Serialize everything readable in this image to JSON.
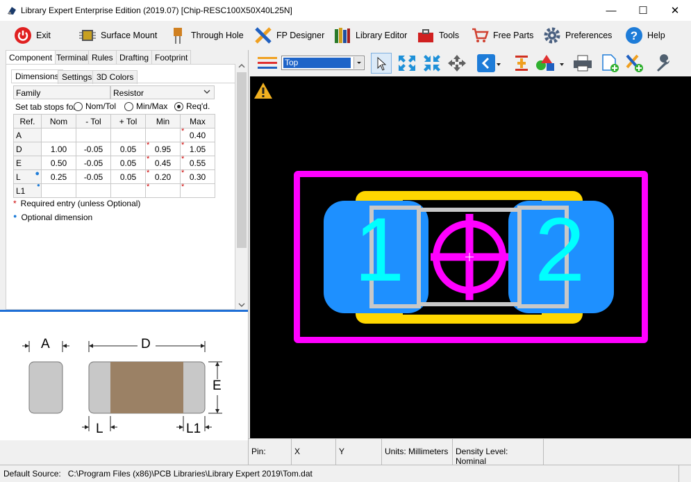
{
  "title": "Library Expert Enterprise Edition (2019.07) [Chip-RESC100X50X40L25N]",
  "window": {
    "minimize": "—",
    "maximize": "☐",
    "close": "✕"
  },
  "toolbar": [
    {
      "label": "Exit",
      "icon": "power-icon"
    },
    {
      "label": "Surface Mount",
      "icon": "chip-icon"
    },
    {
      "label": "Through Hole",
      "icon": "through-hole-icon"
    },
    {
      "label": "FP Designer",
      "icon": "pencil-ruler-icon"
    },
    {
      "label": "Library Editor",
      "icon": "books-icon"
    },
    {
      "label": "Tools",
      "icon": "toolbox-icon"
    },
    {
      "label": "Free Parts",
      "icon": "cart-icon"
    },
    {
      "label": "Preferences",
      "icon": "gear-icon"
    },
    {
      "label": "Help",
      "icon": "help-icon"
    }
  ],
  "tabs": [
    "Component",
    "Terminal",
    "Rules",
    "Drafting",
    "Footprint"
  ],
  "subtabs": [
    "Dimensions",
    "Settings",
    "3D Colors"
  ],
  "family": {
    "label": "Family",
    "value": "Resistor"
  },
  "tabstops": {
    "label": "Set tab stops for:",
    "options": [
      "Nom/Tol",
      "Min/Max",
      "Req'd."
    ],
    "selected": "Req'd."
  },
  "table": {
    "headers": [
      "Ref.",
      "Nom",
      "- Tol",
      "+ Tol",
      "Min",
      "Max"
    ],
    "rows": [
      {
        "ref": "A",
        "nom": "",
        "mtol": "",
        "ptol": "",
        "min": "",
        "max": "0.40",
        "min_req": false,
        "max_req": true,
        "optional": false
      },
      {
        "ref": "D",
        "nom": "1.00",
        "mtol": "-0.05",
        "ptol": "0.05",
        "min": "0.95",
        "max": "1.05",
        "min_req": true,
        "max_req": true,
        "optional": false
      },
      {
        "ref": "E",
        "nom": "0.50",
        "mtol": "-0.05",
        "ptol": "0.05",
        "min": "0.45",
        "max": "0.55",
        "min_req": true,
        "max_req": true,
        "optional": false
      },
      {
        "ref": "L",
        "nom": "0.25",
        "mtol": "-0.05",
        "ptol": "0.05",
        "min": "0.20",
        "max": "0.30",
        "min_req": true,
        "max_req": true,
        "optional": true
      },
      {
        "ref": "L1",
        "nom": "",
        "mtol": "",
        "ptol": "",
        "min": "",
        "max": "",
        "min_req": true,
        "max_req": true,
        "optional": false
      }
    ]
  },
  "legend": {
    "required": "Required entry (unless Optional)",
    "optional": "Optional dimension"
  },
  "diagram": {
    "A": "A",
    "D": "D",
    "E": "E",
    "L": "L",
    "L1": "L1"
  },
  "layer": {
    "value": "Top"
  },
  "canvas": {
    "pad1": "1",
    "pad2": "2"
  },
  "status": {
    "pin": "Pin:",
    "x": "X",
    "y": "Y",
    "units": "Units: Millimeters",
    "density": "Density Level: Nominal"
  },
  "footer": {
    "source": "Default Source:   C:\\Program Files (x86)\\PCB Libraries\\Library Expert 2019\\Tom.dat"
  },
  "colors": {
    "magenta": "#ff00ff",
    "cyan": "#00ffff",
    "pad": "#1e90ff",
    "yellow": "#ffd700"
  }
}
